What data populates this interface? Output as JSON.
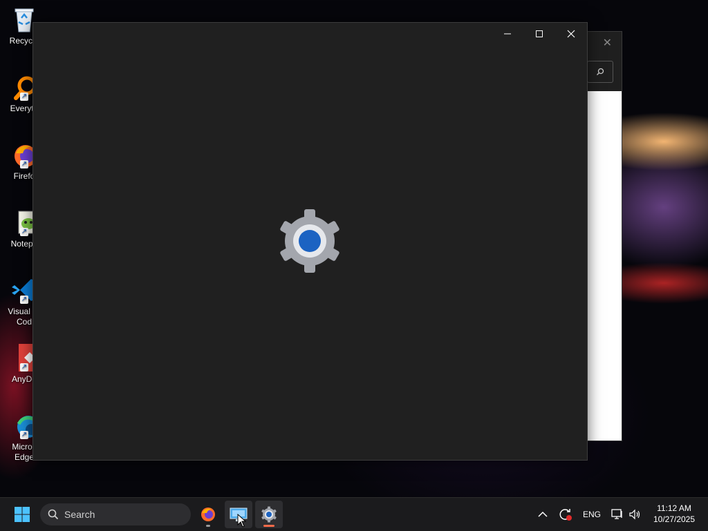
{
  "desktop": {
    "icons": [
      {
        "label": "Recycle",
        "icon": "recycle-bin-icon"
      },
      {
        "label": "Everyth",
        "icon": "everything-search-icon"
      },
      {
        "label": "Firefo",
        "icon": "firefox-icon"
      },
      {
        "label": "Notepa",
        "icon": "notepad-plus-plus-icon"
      },
      {
        "label": "Visual St",
        "label2": "Cod",
        "icon": "vscode-icon"
      },
      {
        "label": "AnyDe",
        "icon": "anydesk-icon"
      },
      {
        "label": "Micros",
        "label2": "Edge",
        "icon": "edge-icon"
      }
    ]
  },
  "settings_window": {
    "minimize": "minimize-icon",
    "maximize": "maximize-icon",
    "close": "close-icon",
    "splash": "settings-gear-icon",
    "colors": {
      "background": "#202020",
      "gear": "#a3a6ad",
      "accent": "#1c63c2"
    }
  },
  "background_window": {
    "close": "close-icon",
    "search": "search-icon"
  },
  "taskbar": {
    "search_label": "Search",
    "apps": [
      "firefox-icon",
      "remote-desktop-icon",
      "settings-icon"
    ],
    "tray": {
      "language": "ENG"
    },
    "clock": {
      "time": "11:12 AM",
      "date": "10/27/2025"
    }
  }
}
